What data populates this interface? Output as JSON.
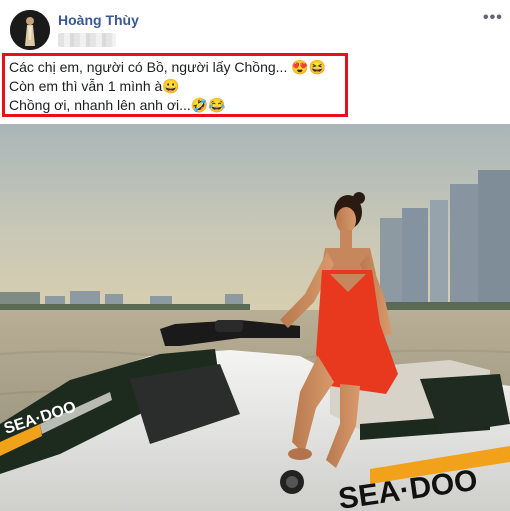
{
  "post": {
    "author_name": "Hoàng Thùy",
    "menu_label": "•••",
    "caption_lines": [
      "Các chị em, người có Bồ, người lấy Chồng... 😍😆",
      "Còn em thì vẫn 1 mình à😀",
      "Chồng ơi, nhanh lên anh ơi...🤣😂"
    ]
  },
  "photo": {
    "hull_text": "SEA·DOO",
    "bow_text": "SEA·DOO"
  },
  "colors": {
    "author_link": "#385898",
    "highlight_border": "#e8101c",
    "dress": "#e8391f",
    "jetski_accent": "#f2a11b"
  }
}
